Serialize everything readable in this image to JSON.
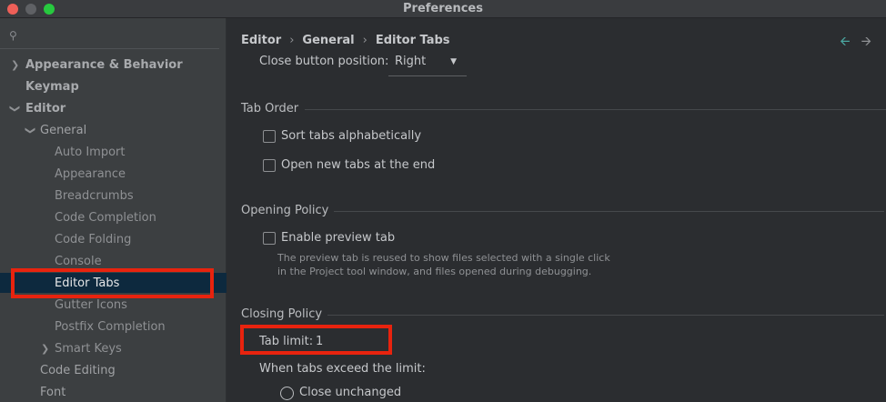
{
  "window": {
    "title": "Preferences"
  },
  "sidebar": {
    "items": [
      {
        "label": "Appearance & Behavior"
      },
      {
        "label": "Keymap"
      },
      {
        "label": "Editor"
      },
      {
        "label": "General"
      },
      {
        "label": "Auto Import"
      },
      {
        "label": "Appearance"
      },
      {
        "label": "Breadcrumbs"
      },
      {
        "label": "Code Completion"
      },
      {
        "label": "Code Folding"
      },
      {
        "label": "Console"
      },
      {
        "label": "Editor Tabs"
      },
      {
        "label": "Gutter Icons"
      },
      {
        "label": "Postfix Completion"
      },
      {
        "label": "Smart Keys"
      },
      {
        "label": "Code Editing"
      },
      {
        "label": "Font"
      }
    ]
  },
  "breadcrumb": [
    "Editor",
    "General",
    "Editor Tabs"
  ],
  "close_button": {
    "label": "Close button position:",
    "value": "Right"
  },
  "tab_order": {
    "title": "Tab Order",
    "options": [
      "Sort tabs alphabetically",
      "Open new tabs at the end"
    ]
  },
  "opening_policy": {
    "title": "Opening Policy",
    "option": "Enable preview tab",
    "help_1": "The preview tab is reused to show files selected with a single click",
    "help_2": "in the Project tool window, and files opened during debugging."
  },
  "closing_policy": {
    "title": "Closing Policy",
    "tab_limit_label": "Tab limit:",
    "tab_limit_value": "1",
    "exceed_label": "When tabs exceed the limit:",
    "radio_label": "Close unchanged"
  },
  "colors": {
    "accent_highlight": "#e8230e",
    "selection": "#0d293e",
    "nav_back": "#4aa6a0"
  }
}
